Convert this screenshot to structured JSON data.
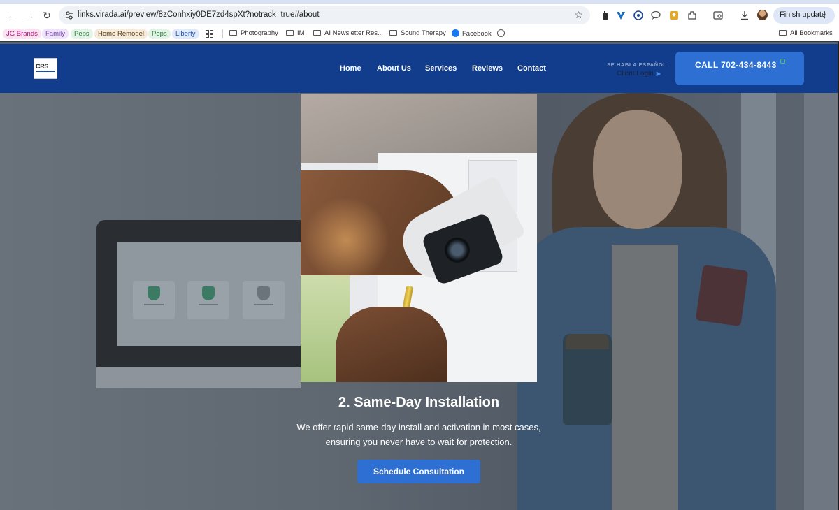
{
  "browser": {
    "url": "links.virada.ai/preview/8zConhxiy0DE7zd4spXt?notrack=true#about",
    "finish_update_label": "Finish update",
    "icons": [
      "back-arrow-icon",
      "forward-arrow-icon",
      "reload-icon",
      "site-info-icon",
      "star-icon",
      "extensions-icon",
      "download-icon",
      "more-vert-icon"
    ]
  },
  "bookmarks": {
    "chips": [
      {
        "label": "JG Brands",
        "color": "#b0127e",
        "bg": "#fbe3f2"
      },
      {
        "label": "Family",
        "color": "#7a3fb8",
        "bg": "#efe5fa"
      },
      {
        "label": "Peps",
        "color": "#247a3a",
        "bg": "#e3f3e6"
      },
      {
        "label": "Home Remodel",
        "color": "#5a3b12",
        "bg": "#f7ecdc"
      },
      {
        "label": "Peps",
        "color": "#247a3a",
        "bg": "#e3f3e6"
      },
      {
        "label": "Liberty",
        "color": "#1f55b8",
        "bg": "#e0eafa"
      }
    ],
    "items": {
      "photography": "Photography",
      "im": "IM",
      "ai_newsletter": "AI Newsletter Res...",
      "sound_therapy": "Sound Therapy",
      "facebook": "Facebook",
      "all_bookmarks": "All Bookmarks"
    }
  },
  "site": {
    "logo_text": "CRS",
    "nav": {
      "home": "Home",
      "about": "About Us",
      "services": "Services",
      "reviews": "Reviews",
      "contact": "Contact"
    },
    "habla": "SE HABLA ESPAÑOL",
    "client_login": "Client Login",
    "call_label": "CALL 702-434-8443",
    "brand_color": "#113d8c",
    "accent_color": "#2d6fd2"
  },
  "hero": {
    "title": "2. Same-Day Installation",
    "text": "We offer rapid same-day install and activation in most cases, ensuring you never have to wait for protection.",
    "cta_label": "Schedule Consultation"
  }
}
